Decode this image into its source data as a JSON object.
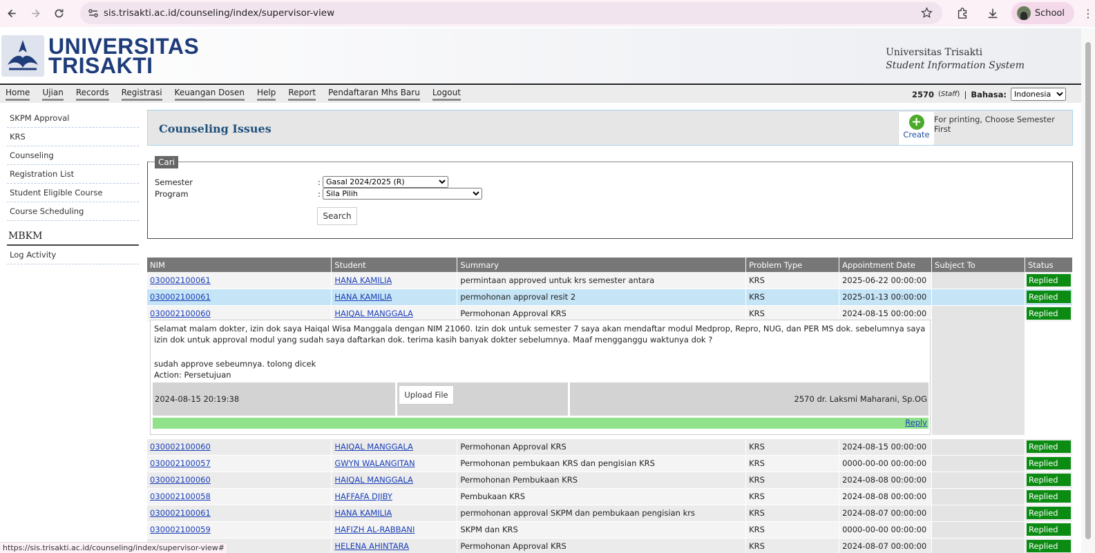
{
  "browser": {
    "url": "sis.trisakti.ac.id/counseling/index/supervisor-view",
    "profile_name": "School",
    "status_url": "https://sis.trisakti.ac.id/counseling/index/supervisor-view#"
  },
  "header": {
    "logo_line1": "UNIVERSITAS",
    "logo_tri": "TRI",
    "logo_sakti": "SAKTI",
    "org_name": "Universitas Trisakti",
    "system_name": "Student Information System"
  },
  "menu": {
    "items": [
      "Home",
      "Ujian",
      "Records",
      "Registrasi",
      "Keuangan Dosen",
      "Help",
      "Report",
      "Pendaftaran Mhs Baru",
      "Logout"
    ],
    "user_id": "2570",
    "user_role": "Staff",
    "separator": "|",
    "language_label": "Bahasa:",
    "language_value": "Indonesia"
  },
  "sidebar": {
    "items": [
      "SKPM Approval",
      "KRS",
      "Counseling",
      "Registration List",
      "Student Eligible Course",
      "Course Scheduling"
    ],
    "section_title": "MBKM",
    "section_items": [
      "Log Activity"
    ]
  },
  "page": {
    "title": "Counseling Issues",
    "create_label": "Create",
    "print_note": "For printing, Choose Semester First"
  },
  "search": {
    "legend": "Cari",
    "semester_label": "Semester",
    "semester_value": "Gasal 2024/2025 (R)",
    "program_label": "Program",
    "program_value": "Sila Pilih",
    "colon": ":",
    "button_label": "Search"
  },
  "table": {
    "headers": [
      "NIM",
      "Student",
      "Summary",
      "Problem Type",
      "Appointment Date",
      "Subject To",
      "Status"
    ],
    "rows": [
      {
        "nim": "030002100061",
        "student": "HANA KAMILIA",
        "summary": "permintaan approved untuk krs semester antara",
        "type": "KRS",
        "date": "2025-06-22 00:00:00",
        "subject": "",
        "status": "Replied"
      },
      {
        "nim": "030002100061",
        "student": "HANA KAMILIA",
        "summary": "permohonan approval resit 2",
        "type": "KRS",
        "date": "2025-01-13 00:00:00",
        "subject": "",
        "status": "Replied"
      },
      {
        "nim": "030002100060",
        "student": "HAIQAL MANGGALA",
        "summary": "Permohonan Approval KRS",
        "type": "KRS",
        "date": "2024-08-15 00:00:00",
        "subject": "",
        "status": "Replied"
      },
      {
        "nim": "030002100060",
        "student": "HAIQAL MANGGALA",
        "summary": "Permohonan Approval KRS",
        "type": "KRS",
        "date": "2024-08-15 00:00:00",
        "subject": "",
        "status": "Replied"
      },
      {
        "nim": "030002100057",
        "student": "GWYN WALANGITAN",
        "summary": "Permohonan pembukaan KRS dan pengisian KRS",
        "type": "KRS",
        "date": "0000-00-00 00:00:00",
        "subject": "",
        "status": "Replied"
      },
      {
        "nim": "030002100060",
        "student": "HAIQAL MANGGALA",
        "summary": "Permohonan Pembukaan KRS",
        "type": "KRS",
        "date": "2024-08-08 00:00:00",
        "subject": "",
        "status": "Replied"
      },
      {
        "nim": "030002100058",
        "student": "HAFFAFA DJIBY",
        "summary": "Pembukaan KRS",
        "type": "KRS",
        "date": "2024-08-08 00:00:00",
        "subject": "",
        "status": "Replied"
      },
      {
        "nim": "030002100061",
        "student": "HANA KAMILIA",
        "summary": "permohonan approval SKPM dan pembukaan pengisian krs",
        "type": "KRS",
        "date": "2024-08-07 00:00:00",
        "subject": "",
        "status": "Replied"
      },
      {
        "nim": "030002100059",
        "student": "HAFIZH AL-RABBANI",
        "summary": "SKPM dan KRS",
        "type": "KRS",
        "date": "0000-00-00 00:00:00",
        "subject": "",
        "status": "Replied"
      },
      {
        "nim": "",
        "student": "HELENA AHINTARA",
        "summary": "Permohonan Approval KRS",
        "type": "KRS",
        "date": "2024-08-07 00:00:00",
        "subject": "",
        "status": "Replied"
      }
    ]
  },
  "detail": {
    "message": "Selamat malam dokter, izin dok saya Haiqal Wisa Manggala dengan NIM 21060. Izin dok untuk semester 7 saya akan mendaftar modul Medprop, Repro, NUG, dan PER MS dok. sebelumnya saya izin dok untuk approval modul yang sudah saya daftarkan dok. terima kasih banyak dokter sebelumnya. Maaf mengganggu waktunya dok ?",
    "reply_line": "sudah approve sebeumnya. tolong dicek",
    "action_line": "Action: Persetujuan",
    "timestamp": "2024-08-15 20:19:38",
    "upload_label": "Upload File",
    "replied_by": "2570 dr. Laksmi Maharani, Sp.OG",
    "reply_link": "Reply"
  }
}
